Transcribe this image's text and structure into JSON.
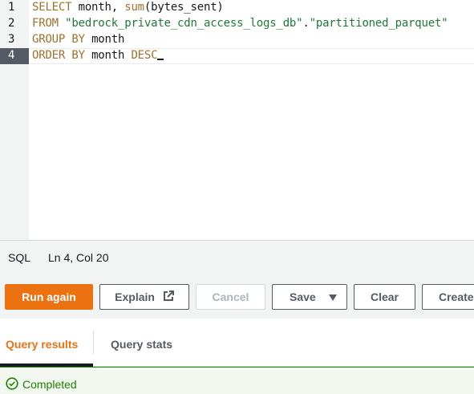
{
  "editor": {
    "lines": [
      {
        "num": "1",
        "tokens": [
          {
            "t": "SELECT",
            "c": "kw"
          },
          {
            "t": " month, ",
            "c": ""
          },
          {
            "t": "sum",
            "c": "fn"
          },
          {
            "t": "(bytes_sent)",
            "c": ""
          }
        ]
      },
      {
        "num": "2",
        "tokens": [
          {
            "t": "FROM",
            "c": "kw"
          },
          {
            "t": " ",
            "c": ""
          },
          {
            "t": "\"bedrock_private_cdn_access_logs_db\"",
            "c": "str"
          },
          {
            "t": ".",
            "c": ""
          },
          {
            "t": "\"partitioned_parquet\"",
            "c": "str"
          }
        ]
      },
      {
        "num": "3",
        "tokens": [
          {
            "t": "GROUP BY",
            "c": "kw"
          },
          {
            "t": " month",
            "c": ""
          }
        ]
      },
      {
        "num": "4",
        "tokens": [
          {
            "t": "ORDER BY",
            "c": "kw"
          },
          {
            "t": " month ",
            "c": ""
          },
          {
            "t": "DESC",
            "c": "kw"
          }
        ]
      }
    ],
    "active_line": 4
  },
  "statusbar": {
    "language": "SQL",
    "position": "Ln 4, Col 20"
  },
  "toolbar": {
    "run_label": "Run again",
    "explain_label": "Explain",
    "cancel_label": "Cancel",
    "save_label": "Save",
    "clear_label": "Clear",
    "create_label": "Create"
  },
  "tabs": {
    "results_label": "Query results",
    "stats_label": "Query stats"
  },
  "result_status": {
    "text": "Completed",
    "color": "#1d8102"
  },
  "colors": {
    "accent": "#ec7211",
    "keyword": "#a3702b",
    "string": "#1d7a37"
  }
}
